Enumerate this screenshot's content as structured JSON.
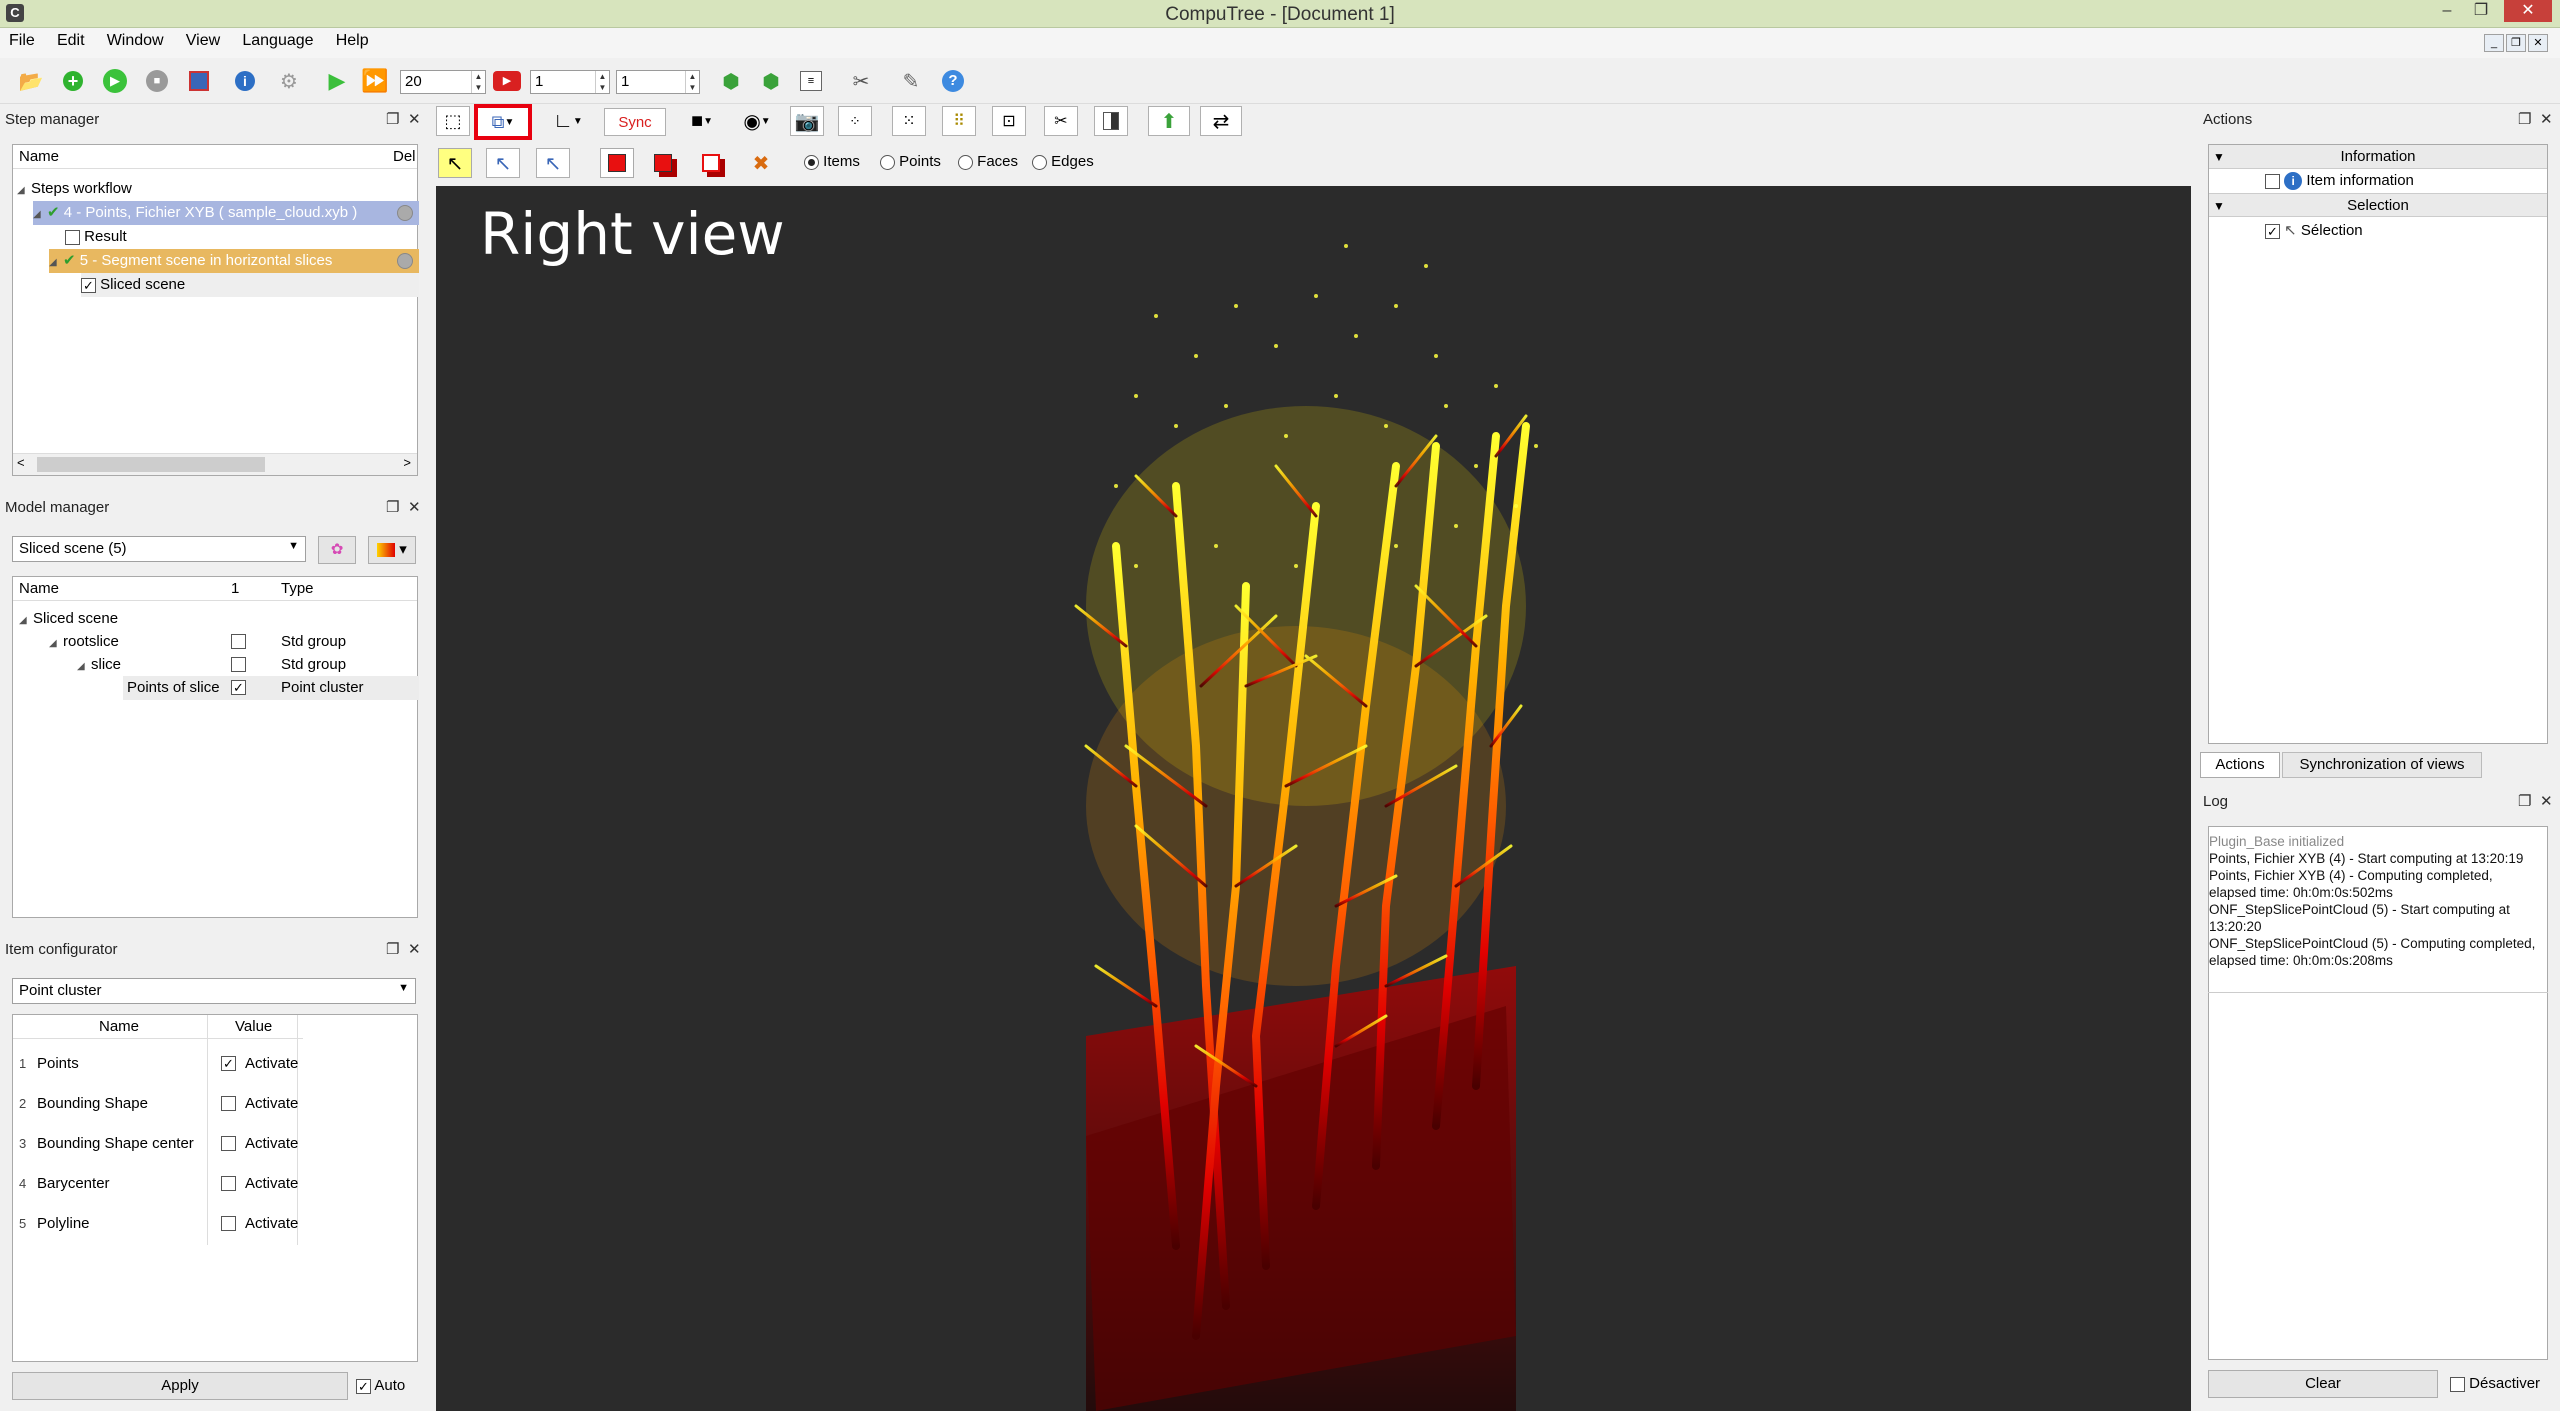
{
  "window": {
    "title": "CompuTree - [Document 1]",
    "app_icon": "C",
    "min": "–",
    "restore": "❐",
    "close": "✕",
    "mdi_min": "_",
    "mdi_restore": "❐",
    "mdi_close": "✕"
  },
  "menu": [
    "File",
    "Edit",
    "Window",
    "View",
    "Language",
    "Help"
  ],
  "toolbar": {
    "step_interval": "20",
    "start_value": "1",
    "end_value": "1"
  },
  "step_manager": {
    "title": "Step manager",
    "col_name": "Name",
    "col_del": "Del",
    "root": "Steps workflow",
    "step4": "4 - Points, Fichier XYB ( sample_cloud.xyb )",
    "result": "Result",
    "step5": "5 - Segment scene in horizontal slices",
    "sliced": "Sliced scene"
  },
  "model_manager": {
    "title": "Model manager",
    "combo_value": "Sliced scene (5)",
    "col_name": "Name",
    "col_1": "1",
    "col_type": "Type",
    "rows": [
      {
        "name": "Sliced scene",
        "type": ""
      },
      {
        "name": "rootslice",
        "type": "Std group"
      },
      {
        "name": "slice",
        "type": "Std group"
      },
      {
        "name": "Points of slice",
        "type": "Point cluster"
      }
    ]
  },
  "item_configurator": {
    "title": "Item configurator",
    "combo_value": "Point cluster",
    "col_name": "Name",
    "col_value": "Value",
    "rows": [
      {
        "num": "1",
        "name": "Points",
        "value": "Activate",
        "checked": true
      },
      {
        "num": "2",
        "name": "Bounding Shape",
        "value": "Activate",
        "checked": false
      },
      {
        "num": "3",
        "name": "Bounding Shape center",
        "value": "Activate",
        "checked": false
      },
      {
        "num": "4",
        "name": "Barycenter",
        "value": "Activate",
        "checked": false
      },
      {
        "num": "5",
        "name": "Polyline",
        "value": "Activate",
        "checked": false
      }
    ],
    "apply": "Apply",
    "auto": "Auto"
  },
  "viewer": {
    "sync": "Sync",
    "view_label": "Right view",
    "mode_items": "Items",
    "mode_points": "Points",
    "mode_faces": "Faces",
    "mode_edges": "Edges",
    "bg_color": "#2b2b2b",
    "highlight_color": "#e8000f"
  },
  "actions_panel": {
    "title": "Actions",
    "group_info": "Information",
    "item_info": "Item information",
    "group_sel": "Selection",
    "item_sel": "Sélection",
    "tab_actions": "Actions",
    "tab_sync": "Synchronization of views"
  },
  "log_panel": {
    "title": "Log",
    "lines": [
      "Plugin_Base initialized",
      "Points, Fichier XYB (4) - Start computing at 13:20:19",
      "Points, Fichier XYB (4) - Computing completed, elapsed time: 0h:0m:0s:502ms",
      "ONF_StepSlicePointCloud (5) - Start computing at 13:20:20",
      "ONF_StepSlicePointCloud (5) - Computing completed, elapsed time: 0h:0m:0s:208ms"
    ],
    "clear": "Clear",
    "disable": "Désactiver"
  }
}
